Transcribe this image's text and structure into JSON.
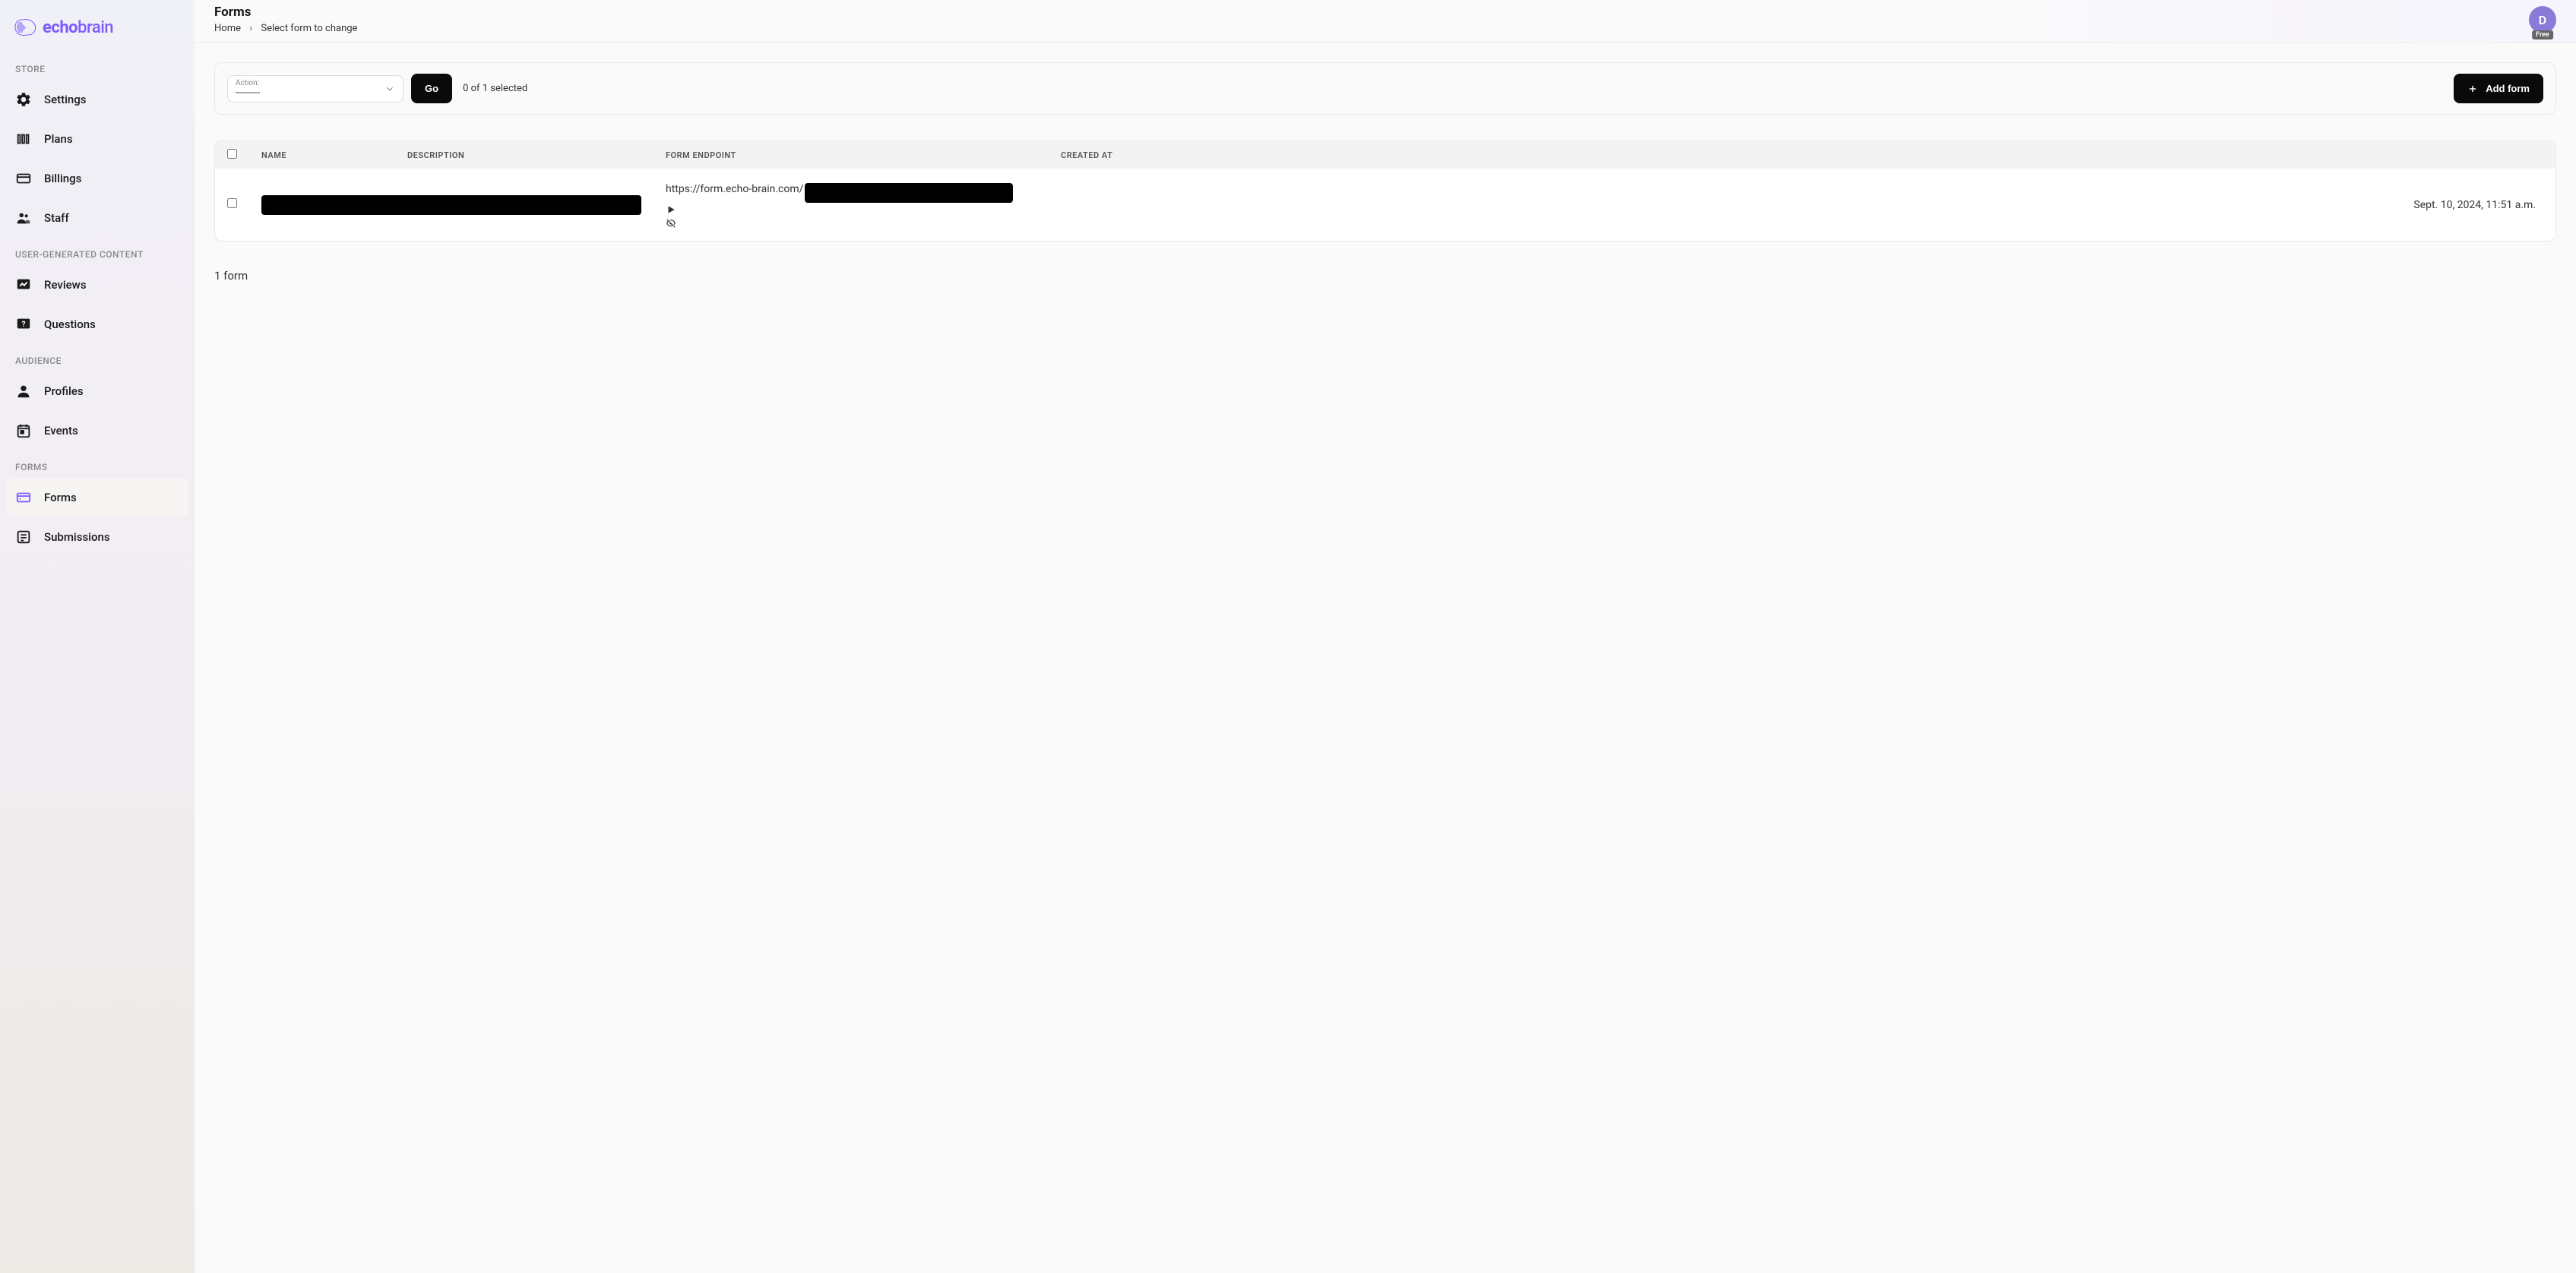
{
  "brand": {
    "name": "echobrain"
  },
  "sidebar": {
    "sections": [
      {
        "label": "STORE"
      },
      {
        "label": "USER-GENERATED CONTENT"
      },
      {
        "label": "AUDIENCE"
      },
      {
        "label": "FORMS"
      }
    ],
    "items": {
      "settings": "Settings",
      "plans": "Plans",
      "billings": "Billings",
      "staff": "Staff",
      "reviews": "Reviews",
      "questions": "Questions",
      "profiles": "Profiles",
      "events": "Events",
      "forms": "Forms",
      "submissions": "Submissions"
    }
  },
  "header": {
    "title": "Forms",
    "breadcrumb_home": "Home",
    "breadcrumb_current": "Select form to change",
    "avatar_initial": "D",
    "avatar_badge": "Free"
  },
  "actionbar": {
    "action_label": "Action:",
    "action_value": "---------",
    "go": "Go",
    "selected": "0 of 1 selected",
    "add": "Add form"
  },
  "table": {
    "cols": {
      "name": "NAME",
      "description": "DESCRIPTION",
      "endpoint": "FORM ENDPOINT",
      "created": "CREATED AT"
    },
    "rows": [
      {
        "name": "",
        "description": "",
        "endpoint_prefix": "https://form.echo-brain.com/",
        "endpoint_suffix": "",
        "created": "Sept. 10, 2024, 11:51 a.m."
      }
    ]
  },
  "footer": {
    "count": "1 form"
  }
}
